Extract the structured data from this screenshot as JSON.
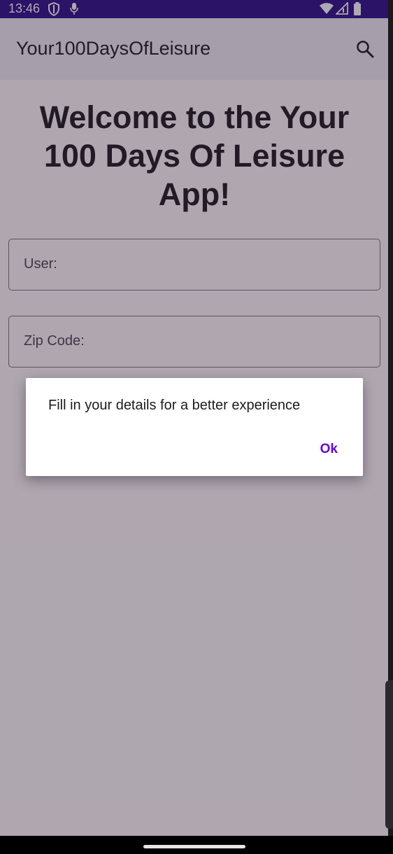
{
  "status_bar": {
    "time": "13:46",
    "background": "#2a0e88"
  },
  "app_bar": {
    "title": "Your100DaysOfLeisure",
    "search_icon": "search-icon"
  },
  "main": {
    "welcome_text": "Welcome to the Your 100 Days Of Leisure App!",
    "user_field_label": "User:",
    "zip_field_label": "Zip Code:"
  },
  "dialog": {
    "message": "Fill in your details for a better experience",
    "ok_label": "Ok",
    "accent": "#6200ee"
  }
}
